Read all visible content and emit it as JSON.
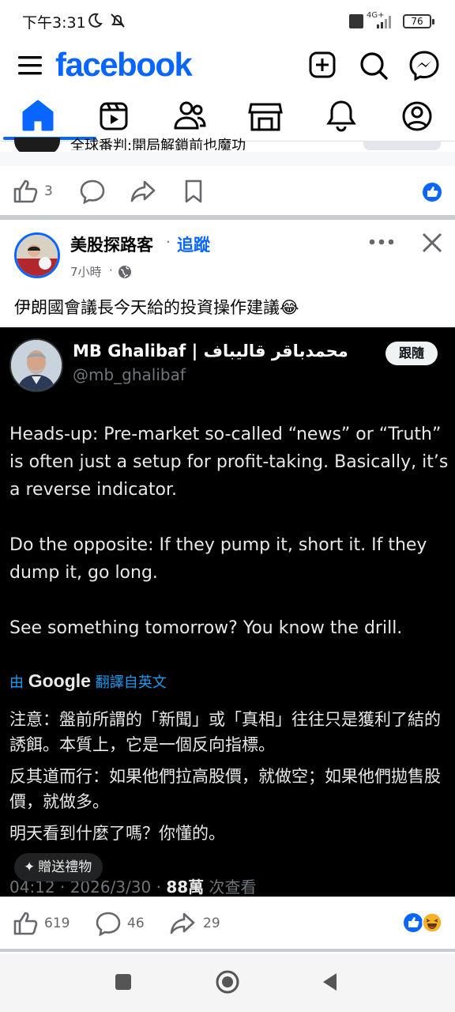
{
  "status_bar": {
    "time": "下午3:31",
    "battery": "76",
    "network": "4G+"
  },
  "header": {
    "logo": "facebook",
    "icons": [
      "menu-icon",
      "create-icon",
      "search-icon",
      "messenger-icon"
    ]
  },
  "tabs": [
    {
      "name": "home",
      "active": true
    },
    {
      "name": "video",
      "active": false
    },
    {
      "name": "friends",
      "active": false
    },
    {
      "name": "marketplace",
      "active": false
    },
    {
      "name": "notifications",
      "active": false
    },
    {
      "name": "profile",
      "active": false
    }
  ],
  "prev_post": {
    "partial_text": "全球番判:開局解鎖前也魔功",
    "like_count": "3"
  },
  "post": {
    "author": "美股探路客",
    "follow_label": "追蹤",
    "time": "7小時",
    "caption": "伊朗國會議長今天給的投資操作建議😂",
    "tweet": {
      "name": "MB Ghalibaf | محمدباقر قالیباف",
      "handle": "@mb_ghalibaf",
      "follow_label": "跟隨",
      "paragraphs": [
        "Heads-up: Pre-market so-called “news” or “Truth” is often just a setup for profit-taking. Basically, it’s a reverse indicator.",
        "Do the opposite: If they pump it, short it. If they dump it, go long.",
        "See something tomorrow? You know the drill."
      ],
      "translate_prefix": "由",
      "translate_brand": "Google",
      "translate_link": "翻譯自英文",
      "translated": [
        "注意：盤前所謂的「新聞」或「真相」往往只是獲利了結的誘餌。本質上，它是一個反向指標。",
        "反其道而行：如果他們拉高股價，就做空；如果他們拋售股價，就做多。",
        "明天看到什麼了嗎？你懂的。"
      ],
      "footer_time": "04:12 · 2026/3/30 ·",
      "footer_views": "88萬",
      "footer_views_label": "次查看"
    },
    "gift_label": "贈送禮物",
    "likes": "619",
    "comments": "46",
    "shares": "29"
  },
  "colors": {
    "brand": "#0866ff",
    "tweet_bg": "#000000"
  }
}
